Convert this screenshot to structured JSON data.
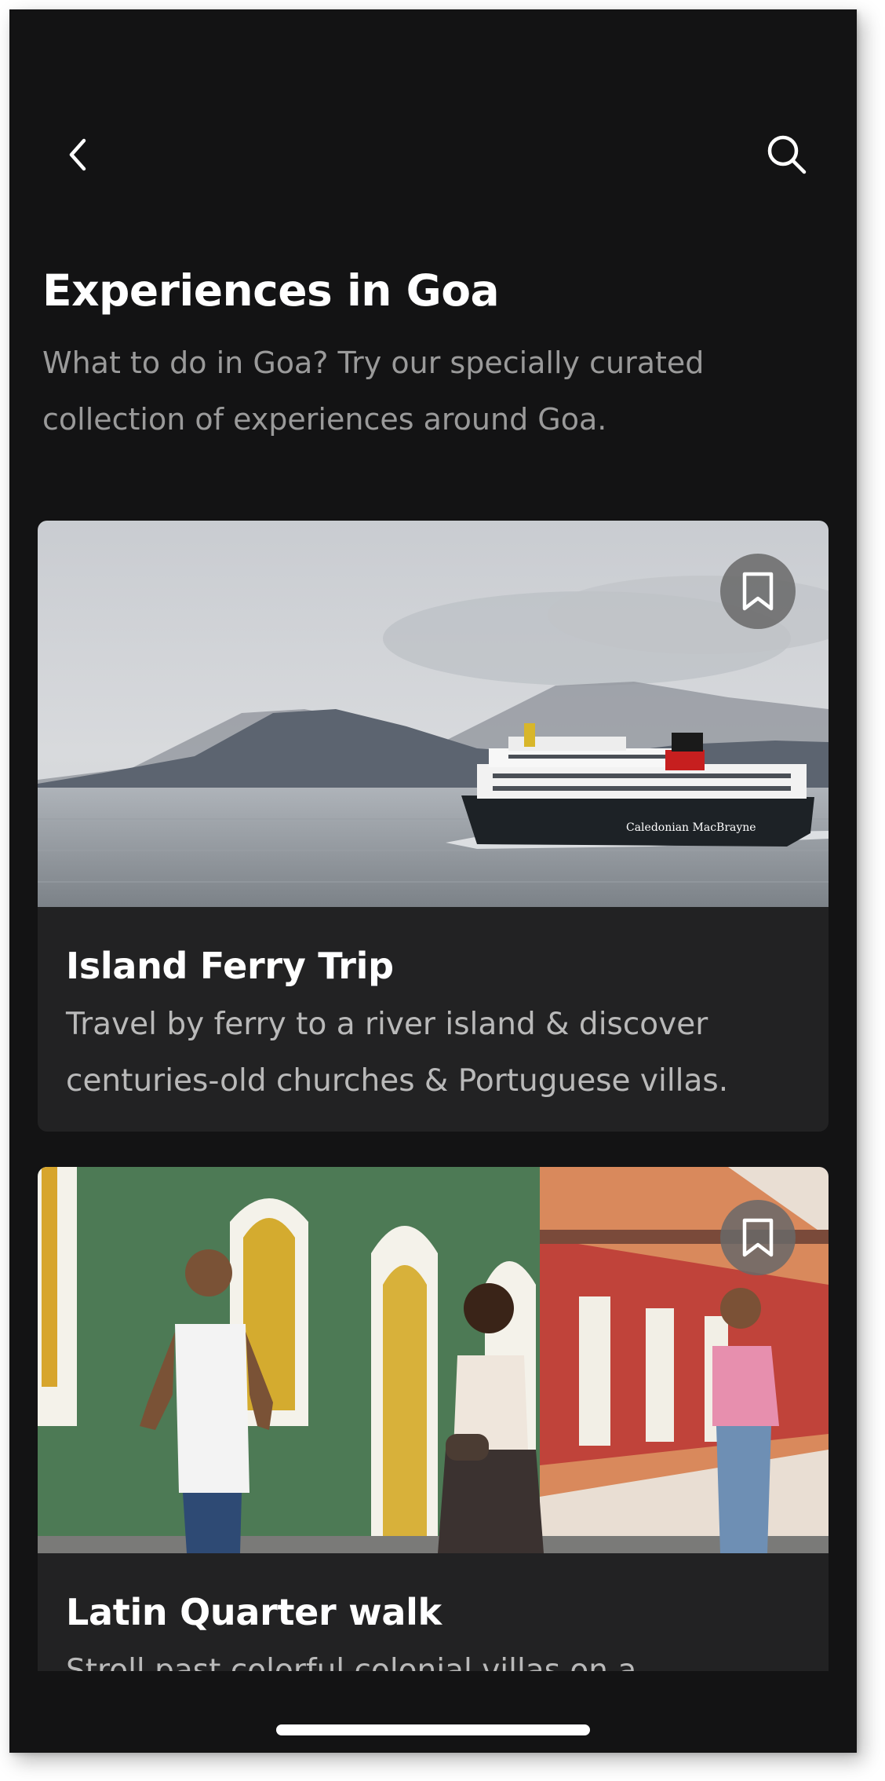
{
  "header": {
    "back_icon": "chevron-left-icon",
    "search_icon": "search-icon"
  },
  "page": {
    "title": "Experiences in Goa",
    "subtitle": "What to do in Goa? Try our specially curated collection of experiences around Goa."
  },
  "experiences": [
    {
      "title": "Island Ferry Trip",
      "description": "Travel by ferry to a river island & discover centuries-old churches & Portuguese villas.",
      "image": "ferry-on-water-photo",
      "ship_text": "Caledonian MacBrayne",
      "bookmark_icon": "bookmark-icon"
    },
    {
      "title": "Latin Quarter walk",
      "description": "Stroll past colorful colonial villas on a",
      "image": "people-walking-colonial-street-photo",
      "bookmark_icon": "bookmark-icon"
    }
  ],
  "colors": {
    "background": "#131314",
    "card": "#222223",
    "subtitle_text": "#9a9a9a",
    "title_text": "#ffffff"
  }
}
